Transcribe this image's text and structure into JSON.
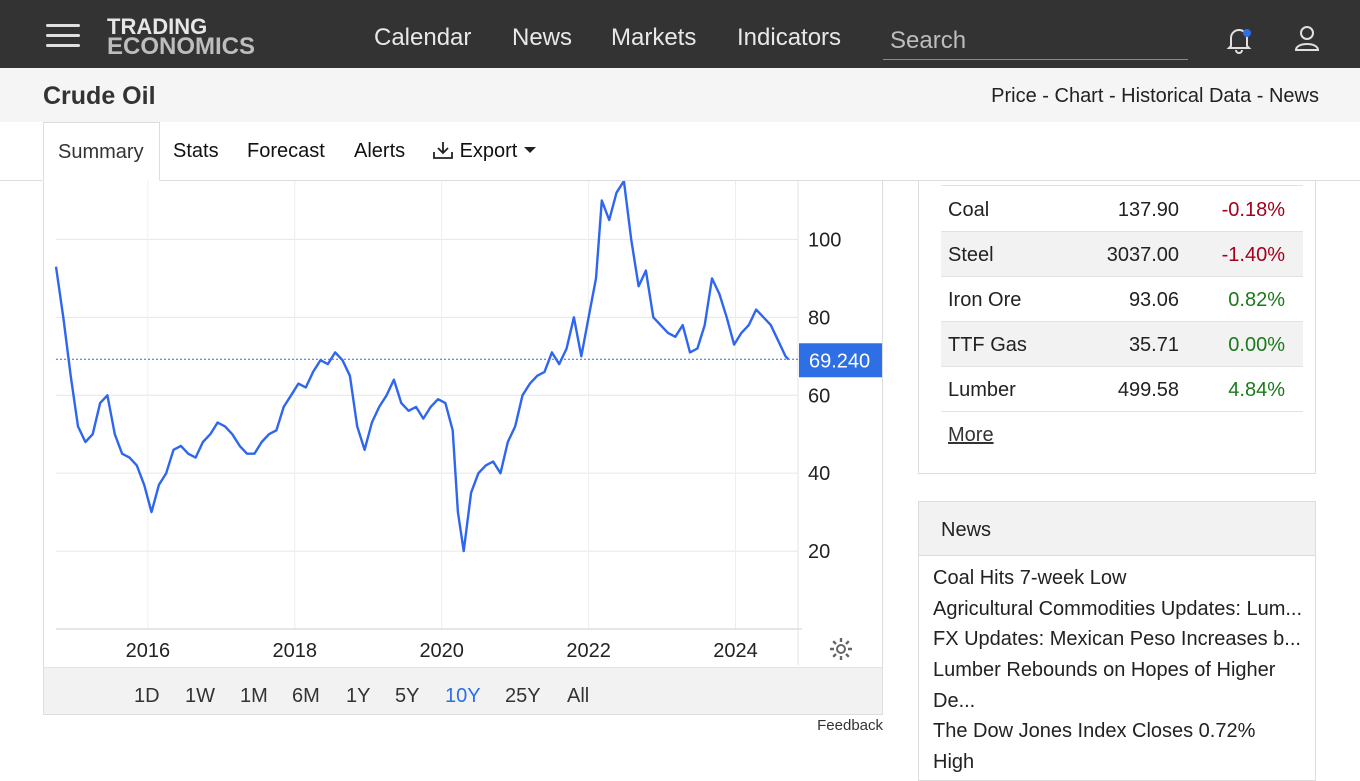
{
  "logo": {
    "line1": "TRADING",
    "line2": "ECONOMICS"
  },
  "nav": {
    "items": [
      "Calendar",
      "News",
      "Markets",
      "Indicators"
    ]
  },
  "search": {
    "placeholder": "Search"
  },
  "page": {
    "title": "Crude Oil",
    "breadcrumb": "Price - Chart - Historical Data - News"
  },
  "tabs": {
    "summary": "Summary",
    "stats": "Stats",
    "forecast": "Forecast",
    "alerts": "Alerts",
    "export": "Export"
  },
  "ranges": {
    "items": [
      "1D",
      "1W",
      "1M",
      "6M",
      "1Y",
      "5Y",
      "10Y",
      "25Y",
      "All"
    ],
    "active": "10Y"
  },
  "feedback": "Feedback",
  "colors": {
    "line": "#2e66f0",
    "badge": "#2e6fe6",
    "topbar": "#333333",
    "negative": "#a4001e",
    "positive": "#1a7a1a"
  },
  "commodities": {
    "rows": [
      {
        "name": "Coal",
        "price": "137.90",
        "change": "-0.18%"
      },
      {
        "name": "Steel",
        "price": "3037.00",
        "change": "-1.40%"
      },
      {
        "name": "Iron Ore",
        "price": "93.06",
        "change": "0.82%"
      },
      {
        "name": "TTF Gas",
        "price": "35.71",
        "change": "0.00%"
      },
      {
        "name": "Lumber",
        "price": "499.58",
        "change": "4.84%"
      }
    ],
    "more": "More"
  },
  "news": {
    "title": "News",
    "items": [
      "Coal Hits 7-week Low",
      "Agricultural Commodities Updates: Lum...",
      "FX Updates: Mexican Peso Increases b...",
      "Lumber Rebounds on Hopes of Higher",
      "De...",
      "The Dow Jones Index Closes 0.72%",
      "High"
    ]
  },
  "chart_data": {
    "type": "line",
    "title": "",
    "xlabel": "",
    "ylabel": "",
    "x_ticks": [
      "2016",
      "2018",
      "2020",
      "2022",
      "2024"
    ],
    "y_ticks": [
      20,
      40,
      60,
      80,
      100
    ],
    "ylim": [
      0,
      115
    ],
    "xlim": [
      2014.75,
      2024.85
    ],
    "grid": true,
    "last_value_label": "69.240",
    "last_value": 69.24,
    "series": [
      {
        "x": [
          2014.75,
          2014.85,
          2014.95,
          2015.05,
          2015.15,
          2015.25,
          2015.35,
          2015.45,
          2015.55,
          2015.65,
          2015.75,
          2015.85,
          2015.95,
          2016.05,
          2016.15,
          2016.25,
          2016.35,
          2016.45,
          2016.55,
          2016.65,
          2016.75,
          2016.85,
          2016.95,
          2017.05,
          2017.15,
          2017.25,
          2017.35,
          2017.45,
          2017.55,
          2017.65,
          2017.75,
          2017.85,
          2017.95,
          2018.05,
          2018.15,
          2018.25,
          2018.35,
          2018.45,
          2018.55,
          2018.65,
          2018.75,
          2018.85,
          2018.95,
          2019.05,
          2019.15,
          2019.25,
          2019.35,
          2019.45,
          2019.55,
          2019.65,
          2019.75,
          2019.85,
          2019.95,
          2020.05,
          2020.15,
          2020.22,
          2020.3,
          2020.4,
          2020.5,
          2020.6,
          2020.7,
          2020.8,
          2020.9,
          2021.0,
          2021.1,
          2021.2,
          2021.3,
          2021.4,
          2021.5,
          2021.6,
          2021.7,
          2021.8,
          2021.9,
          2022.0,
          2022.1,
          2022.18,
          2022.28,
          2022.38,
          2022.48,
          2022.58,
          2022.68,
          2022.78,
          2022.88,
          2022.98,
          2023.08,
          2023.18,
          2023.28,
          2023.38,
          2023.48,
          2023.58,
          2023.68,
          2023.78,
          2023.88,
          2023.98,
          2024.08,
          2024.18,
          2024.28,
          2024.38,
          2024.48,
          2024.58,
          2024.68,
          2024.72
        ],
        "y": [
          93,
          80,
          65,
          52,
          48,
          50,
          58,
          60,
          50,
          45,
          44,
          42,
          37,
          30,
          37,
          40,
          46,
          47,
          45,
          44,
          48,
          50,
          53,
          52,
          50,
          47,
          45,
          45,
          48,
          50,
          51,
          57,
          60,
          63,
          62,
          66,
          69,
          68,
          71,
          69,
          65,
          52,
          46,
          53,
          57,
          60,
          64,
          58,
          56,
          57,
          54,
          57,
          59,
          58,
          51,
          30,
          20,
          35,
          40,
          42,
          43,
          40,
          48,
          52,
          60,
          63,
          65,
          66,
          71,
          68,
          72,
          80,
          70,
          80,
          90,
          110,
          105,
          112,
          115,
          100,
          88,
          92,
          80,
          78,
          76,
          75,
          78,
          71,
          72,
          78,
          90,
          86,
          80,
          73,
          76,
          78,
          82,
          80,
          78,
          74,
          70,
          69.24
        ]
      }
    ]
  }
}
